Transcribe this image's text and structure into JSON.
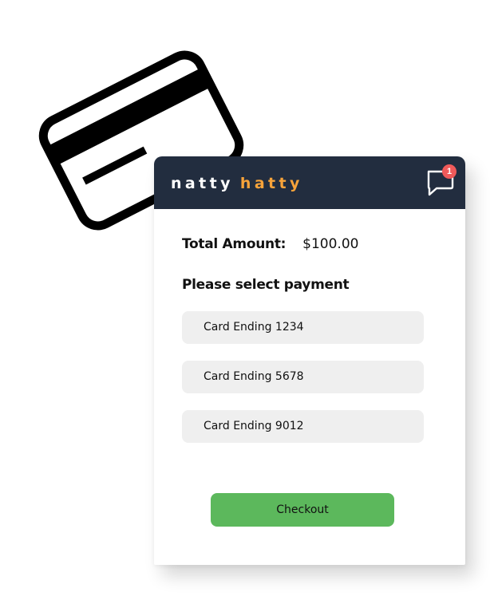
{
  "brand": {
    "first": "natty",
    "second": "hatty",
    "colors": {
      "header_bg": "#222d3f",
      "first": "#ffffff",
      "second": "#f7a33a"
    }
  },
  "header": {
    "chat_icon": "chat-bubble-icon",
    "notification_count": "1",
    "badge_color": "#f05a5a"
  },
  "summary": {
    "total_label": "Total Amount:",
    "total_value": "$100.00"
  },
  "payment": {
    "title": "Please select payment",
    "options": [
      {
        "label": "Card Ending 1234"
      },
      {
        "label": "Card Ending 5678"
      },
      {
        "label": "Card Ending 9012"
      }
    ]
  },
  "checkout": {
    "label": "Checkout",
    "color": "#5cb85c"
  },
  "illustration": {
    "icon": "credit-card-icon"
  }
}
